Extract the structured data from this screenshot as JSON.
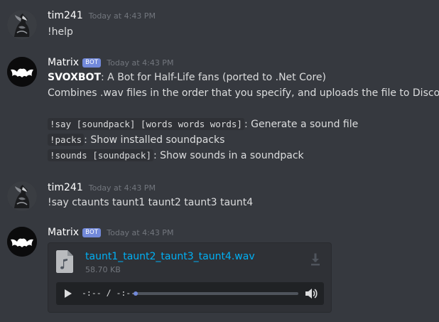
{
  "colors": {
    "background": "#36393f",
    "username": "#ffffff",
    "message_text": "#dcddde",
    "timestamp": "#72767d",
    "bot_tag": "#7289da",
    "link": "#00b0f4",
    "code_background": "#2f3136",
    "player_background": "#202225"
  },
  "messages": [
    {
      "username": "tim241",
      "timestamp": "Today at 4:43 PM",
      "text": "!help"
    },
    {
      "username": "Matrix",
      "bot_tag": "BOT",
      "timestamp": "Today at 4:43 PM",
      "intro": {
        "bold": "SVOXBOT",
        "rest": ": A Bot for Half-Life fans (ported to .Net Core)"
      },
      "description": "Combines .wav files in the order that you specify, and uploads the file to Discord",
      "commands": [
        {
          "code": "!say [soundpack] [words words words]",
          "desc": ": Generate a sound file"
        },
        {
          "code": "!packs",
          "desc": ": Show installed soundpacks"
        },
        {
          "code": "!sounds [soundpack]",
          "desc": ": Show sounds in a soundpack"
        }
      ]
    },
    {
      "username": "tim241",
      "timestamp": "Today at 4:43 PM",
      "text": "!say ctaunts taunt1 taunt2 taunt3 taunt4"
    },
    {
      "username": "Matrix",
      "bot_tag": "BOT",
      "timestamp": "Today at 4:43 PM",
      "attachment": {
        "file_icon": "audio-file-icon",
        "filename": "taunt1_taunt2_taunt3_taunt4.wav",
        "size": "58.70 KB",
        "download_icon": "download-icon",
        "player": {
          "play_icon": "play-icon",
          "time": "-:-- / -:--",
          "progress": 0,
          "volume_icon": "volume-icon"
        }
      }
    }
  ]
}
